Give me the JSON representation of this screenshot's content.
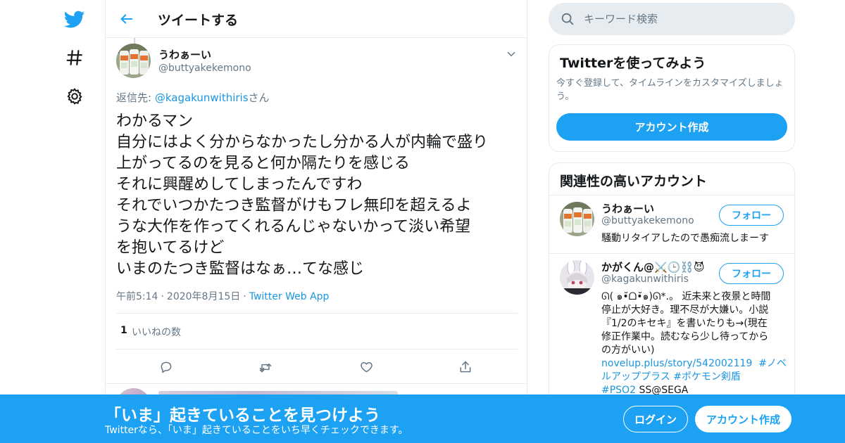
{
  "colors": {
    "accent": "#1da1f2",
    "link": "#1b95e0",
    "text": "#14171a",
    "secondary": "#657786",
    "border": "#e6ecf0"
  },
  "nav": {
    "items": [
      {
        "icon": "twitter-bird-icon"
      },
      {
        "icon": "hashtag-icon"
      },
      {
        "icon": "gear-icon"
      }
    ]
  },
  "header": {
    "title": "ツイートする",
    "back_icon": "arrow-left-icon"
  },
  "tweet": {
    "user_name": "うわぁーい",
    "user_handle": "@buttyakekemono",
    "reply_prefix": "返信先: ",
    "reply_handle": "@kagakunwithiris",
    "reply_suffix": "さん",
    "lines": [
      "わかるマン",
      "自分にはよく分からなかったし分かる人が内輪で盛り",
      "上がってるのを見ると何か隔たりを感じる",
      "それに興醒めしてしまったんですわ",
      "それでいつかたつき監督がけもフレ無印を超えるよ",
      "うな大作を作ってくれるんじゃないかって淡い希望",
      "を抱いてるけど",
      "いまのたつき監督はなぁ…てな感じ"
    ],
    "time": "午前5:14",
    "date": "2020年8月15日",
    "separator": "·",
    "app": "Twitter Web App",
    "like_count": "1",
    "like_label": "いいねの数",
    "actions": [
      "reply-icon",
      "retweet-icon",
      "like-icon",
      "share-icon"
    ]
  },
  "search": {
    "placeholder": "キーワード検索"
  },
  "signup_card": {
    "title": "Twitterを使ってみよう",
    "description": "今すぐ登録して、タイムラインをカスタマイズしましょう。",
    "button": "アカウント作成"
  },
  "related": {
    "title": "関連性の高いアカウント",
    "accounts": [
      {
        "name": "うわぁーい",
        "handle": "@buttyakekemono",
        "follow": "フォロー",
        "bio": "騒動リタイアしたので愚痴流しまーす"
      },
      {
        "name": "かがくん@⚔️🕒⛓️😈",
        "handle": "@kagakunwithiris",
        "follow": "フォロー",
        "bio_lines": [
          "ᘏ( ๑•̆ᗝ•̆๑)ᘏ*.。 近未来と夜景と時間",
          "停止が大好き。理不尽が大嫌い。小説",
          "『1/2のキセキ』を書いたりも→(現在",
          "修正作業中。読むなら少し待ってから",
          "の方がいい)"
        ],
        "link_line1": "novelup.plus/story/542002119",
        "tag1": "#ノベ",
        "tag1_cont": "ルアッププラス",
        "tag2": "#ポケモン剣盾",
        "tag3": "#PSO2",
        "tail": " SS@SEGA"
      }
    ]
  },
  "banner": {
    "title": "「いま」起きていることを見つけよう",
    "subtitle": "Twitterなら、「いま」起きていることをいち早くチェックできます。",
    "login": "ログイン",
    "signup": "アカウント作成"
  }
}
